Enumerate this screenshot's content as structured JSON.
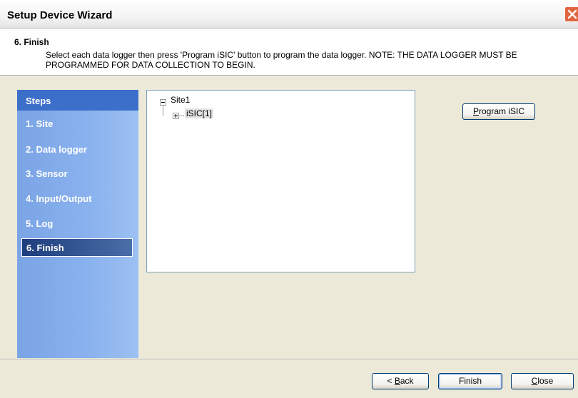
{
  "window": {
    "title": "Setup Device Wizard",
    "close_icon": "close-icon"
  },
  "header": {
    "step_title": "6. Finish",
    "description": "Select each data logger then press 'Program iSIC' button to program the data logger.  NOTE: THE DATA LOGGER MUST BE PROGRAMMED FOR DATA COLLECTION TO BEGIN."
  },
  "steps": {
    "heading": "Steps",
    "items": [
      "1. Site",
      "2. Data logger",
      "3. Sensor",
      "4. Input/Output",
      "5. Log",
      "6. Finish"
    ],
    "active_index": 5
  },
  "tree": {
    "root": {
      "label": "Site1",
      "expanded": true
    },
    "children": [
      {
        "label": "iSIC[1]",
        "expanded": false,
        "selected": true
      }
    ]
  },
  "buttons": {
    "program": {
      "mnemonic": "P",
      "rest": "rogram iSIC"
    },
    "back": {
      "prefix": "< ",
      "mnemonic": "B",
      "rest": "ack"
    },
    "finish": "Finish",
    "close": {
      "mnemonic": "C",
      "rest": "lose"
    }
  },
  "colors": {
    "steps_panel": "#8ab2ee",
    "steps_header": "#3b6fc9",
    "active_step": "#1e3e7d",
    "close_button": "#e0653f"
  }
}
